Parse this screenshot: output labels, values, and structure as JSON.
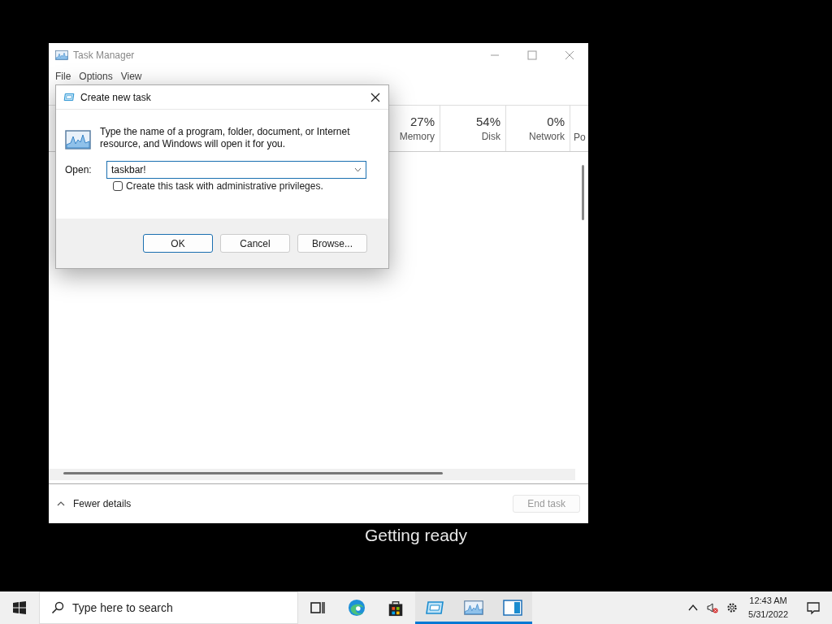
{
  "task_manager": {
    "title": "Task Manager",
    "menu": [
      "File",
      "Options",
      "View"
    ],
    "columns": [
      {
        "value": "27%",
        "label": "Memory"
      },
      {
        "value": "54%",
        "label": "Disk"
      },
      {
        "value": "0%",
        "label": "Network"
      },
      {
        "label": "Po"
      }
    ],
    "footer": {
      "toggle": "Fewer details",
      "end_task": {
        "label": "End task",
        "disabled": true
      }
    }
  },
  "dialog": {
    "title": "Create new task",
    "message": "Type the name of a program, folder, document, or Internet resource, and Windows will open it for you.",
    "open_label": "Open:",
    "open_value": "taskbar!",
    "admin_checkbox": {
      "label": "Create this task with administrative privileges.",
      "checked": false
    },
    "buttons": [
      {
        "label": "OK",
        "default": true
      },
      {
        "label": "Cancel",
        "default": false
      },
      {
        "label": "Browse...",
        "default": false
      }
    ]
  },
  "status_text": "Getting ready",
  "taskbar": {
    "search_placeholder": "Type here to search",
    "apps": [
      {
        "kind": "taskview",
        "running": false
      },
      {
        "kind": "edge",
        "running": false
      },
      {
        "kind": "store",
        "running": false
      },
      {
        "kind": "run",
        "running": true
      },
      {
        "kind": "taskmanager",
        "running": true
      },
      {
        "kind": "window",
        "running": true
      }
    ],
    "time": "12:43 AM",
    "date": "5/31/2022"
  }
}
